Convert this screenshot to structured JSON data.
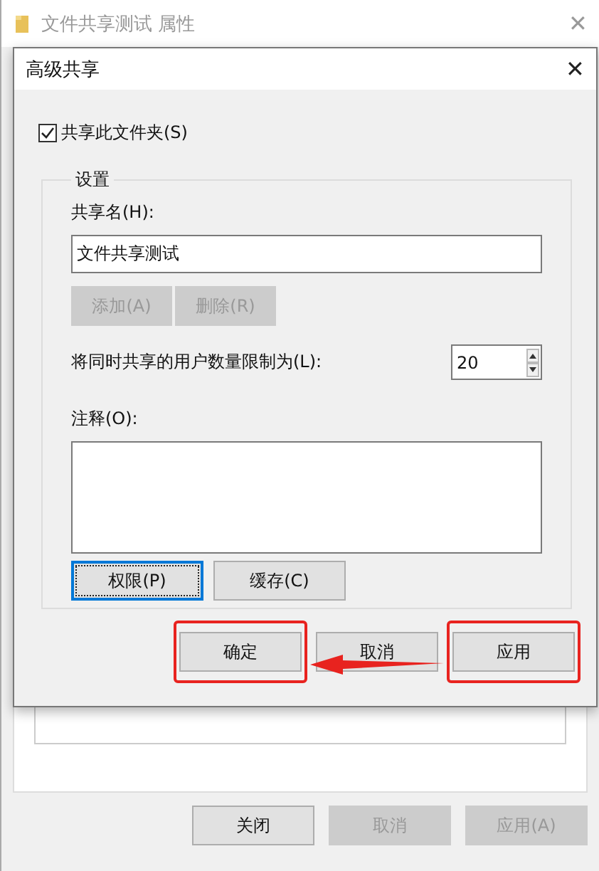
{
  "window": {
    "title": "文件共享测试 属性",
    "close": "✕"
  },
  "dialog": {
    "title": "高级共享",
    "close": "✕",
    "share_checkbox": {
      "label": "共享此文件夹(S)",
      "checked": true
    },
    "group": {
      "title": "设置",
      "share_name": {
        "label": "共享名(H):",
        "value": "文件共享测试"
      },
      "name_buttons": [
        {
          "label": "添加(A)",
          "disabled": true
        },
        {
          "label": "删除(R)",
          "disabled": true
        }
      ],
      "limit": {
        "label": "将同时共享的用户数量限制为(L):",
        "value": "20"
      },
      "comment": {
        "label": "注释(O):"
      },
      "buttons": [
        {
          "label": "权限(P)",
          "focused": true
        },
        {
          "label": "缓存(C)",
          "focused": false
        }
      ]
    },
    "buttons": [
      {
        "label": "确定",
        "highlighted": true
      },
      {
        "label": "取消",
        "highlighted": false
      },
      {
        "label": "应用",
        "highlighted": true
      }
    ],
    "annotation_arrow": true
  },
  "buttons": [
    {
      "label": "关闭",
      "disabled": false
    },
    {
      "label": "取消",
      "disabled": true
    },
    {
      "label": "应用(A)",
      "disabled": true
    }
  ]
}
